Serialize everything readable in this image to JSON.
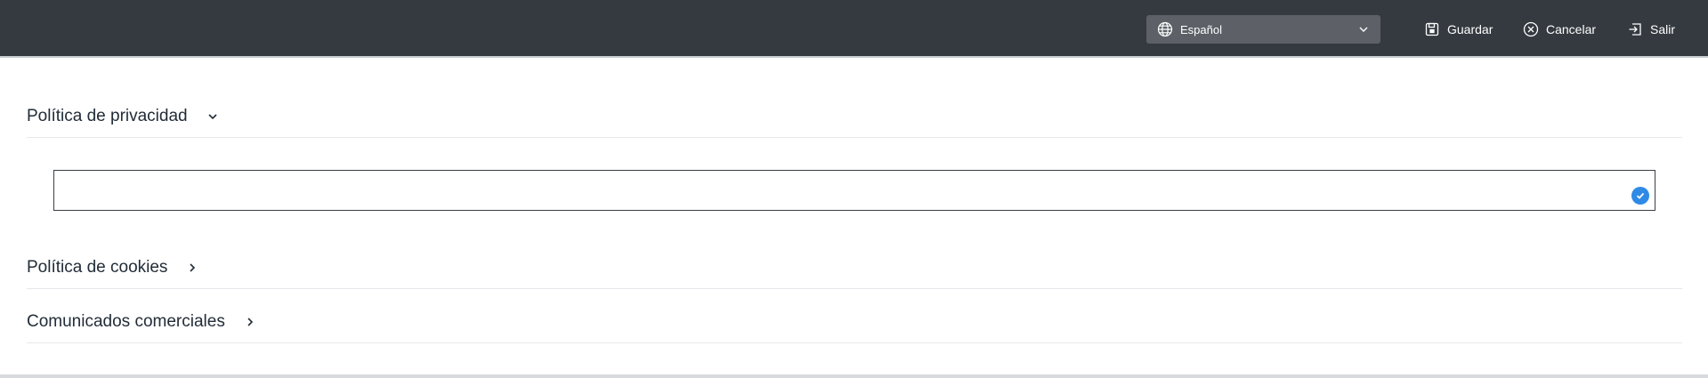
{
  "toolbar": {
    "language_select": {
      "value": "Español",
      "icon": "globe-icon"
    },
    "save_label": "Guardar",
    "cancel_label": "Cancelar",
    "exit_label": "Salir"
  },
  "sections": [
    {
      "title": "Política de privacidad",
      "expanded": true
    },
    {
      "title": "Política de cookies",
      "expanded": false
    },
    {
      "title": "Comunicados comerciales",
      "expanded": false
    }
  ],
  "editor": {
    "value": ""
  },
  "colors": {
    "topbar": "#353a41",
    "select_bg": "#5d6167",
    "accent": "#2f8ae6"
  }
}
